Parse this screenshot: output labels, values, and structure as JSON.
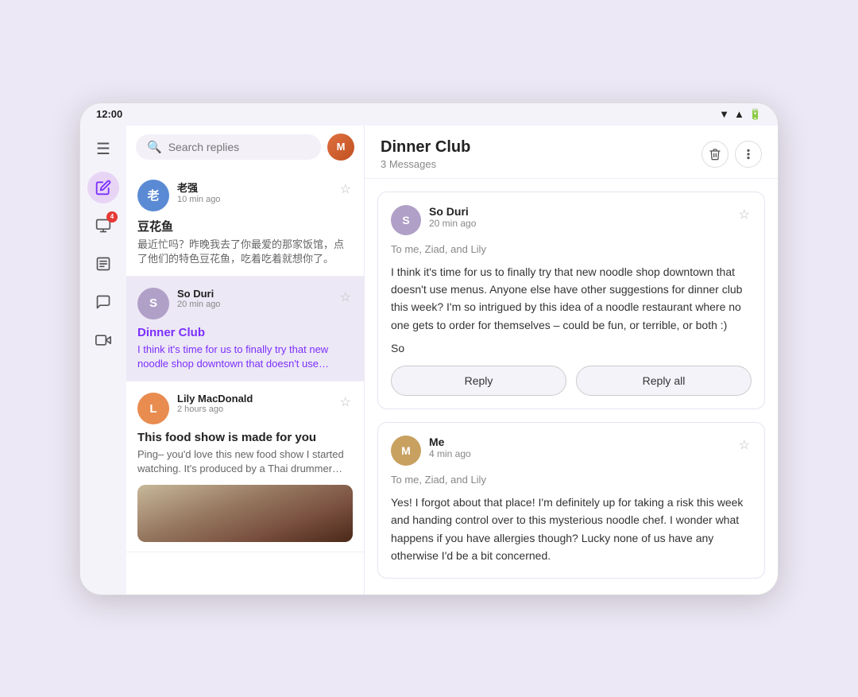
{
  "status_bar": {
    "time": "12:00"
  },
  "sidebar": {
    "icons": [
      {
        "name": "menu-icon",
        "symbol": "☰",
        "active": false,
        "badge": null
      },
      {
        "name": "compose-icon",
        "symbol": "✏️",
        "active": true,
        "badge": null
      },
      {
        "name": "inbox-icon",
        "symbol": "📥",
        "active": false,
        "badge": "4"
      },
      {
        "name": "notes-icon",
        "symbol": "☰",
        "active": false,
        "badge": null
      },
      {
        "name": "chat-icon",
        "symbol": "💬",
        "active": false,
        "badge": null
      },
      {
        "name": "video-icon",
        "symbol": "🎥",
        "active": false,
        "badge": null
      }
    ]
  },
  "search": {
    "placeholder": "Search replies"
  },
  "messages": [
    {
      "id": 1,
      "sender": "老强",
      "time": "10 min ago",
      "subject": "豆花鱼",
      "preview": "最近忙吗？昨晚我去了你最爱的那家饭馆，点了他们的特色豆花鱼，吃着吃着就想你了。",
      "active": false,
      "avatar_color": "#5b8ad4",
      "avatar_text": "老",
      "has_image": false
    },
    {
      "id": 2,
      "sender": "So Duri",
      "time": "20 min ago",
      "subject": "Dinner Club",
      "preview": "I think it's time for us to finally try that new noodle shop downtown that doesn't use menus. Anyone...",
      "active": true,
      "avatar_color": "#b0a0c8",
      "avatar_text": "S",
      "has_image": false
    },
    {
      "id": 3,
      "sender": "Lily MacDonald",
      "time": "2 hours ago",
      "subject": "This food show is made for you",
      "preview": "Ping– you'd love this new food show I started watching. It's produced by a Thai drummer who...",
      "active": false,
      "avatar_color": "#e88c50",
      "avatar_text": "L",
      "has_image": true
    }
  ],
  "detail": {
    "title": "Dinner Club",
    "count": "3 Messages",
    "emails": [
      {
        "id": 1,
        "sender": "So Duri",
        "time": "20 min ago",
        "to": "To me, Ziad, and Lily",
        "body": "I think it's time for us to finally try that new noodle shop downtown that doesn't use menus. Anyone else have other suggestions for dinner club this week? I'm so intrigued by this idea of a noodle restaurant where no one gets to order for themselves – could be fun, or terrible, or both :)",
        "sig": "So",
        "avatar_color": "#b0a0c8",
        "avatar_text": "S",
        "show_reply_buttons": true,
        "reply_label": "Reply",
        "reply_all_label": "Reply all"
      },
      {
        "id": 2,
        "sender": "Me",
        "time": "4 min ago",
        "to": "To me, Ziad, and Lily",
        "body": "Yes! I forgot about that place! I'm definitely up for taking a risk this week and handing control over to this mysterious noodle chef. I wonder what happens if you have allergies though? Lucky none of us have any otherwise I'd be a bit concerned.",
        "sig": "",
        "avatar_color": "#c8a060",
        "avatar_text": "M",
        "show_reply_buttons": false
      }
    ]
  }
}
